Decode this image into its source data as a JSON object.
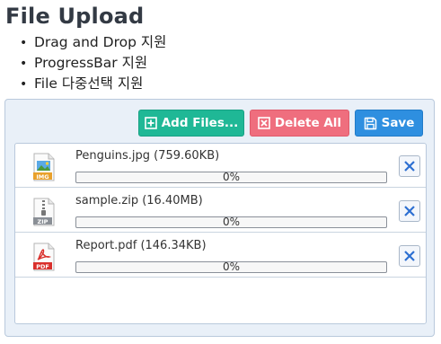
{
  "page": {
    "title": "File Upload",
    "features": [
      "Drag and Drop 지원",
      "ProgressBar 지원",
      "File 다중선택 지원"
    ]
  },
  "toolbar": {
    "add_label": "Add Files...",
    "delete_label": "Delete All",
    "save_label": "Save"
  },
  "files": [
    {
      "name": "Penguins.jpg (759.60KB)",
      "type_badge": "IMG",
      "progress": 0,
      "progress_label": "0%"
    },
    {
      "name": "sample.zip (16.40MB)",
      "type_badge": "ZIP",
      "progress": 0,
      "progress_label": "0%"
    },
    {
      "name": "Report.pdf (146.34KB)",
      "type_badge": "PDF",
      "progress": 0,
      "progress_label": "0%"
    }
  ],
  "colors": {
    "add": "#1fb896",
    "delete": "#ef6e7e",
    "save": "#2e8fe0",
    "remove_x": "#2d6fd1"
  }
}
